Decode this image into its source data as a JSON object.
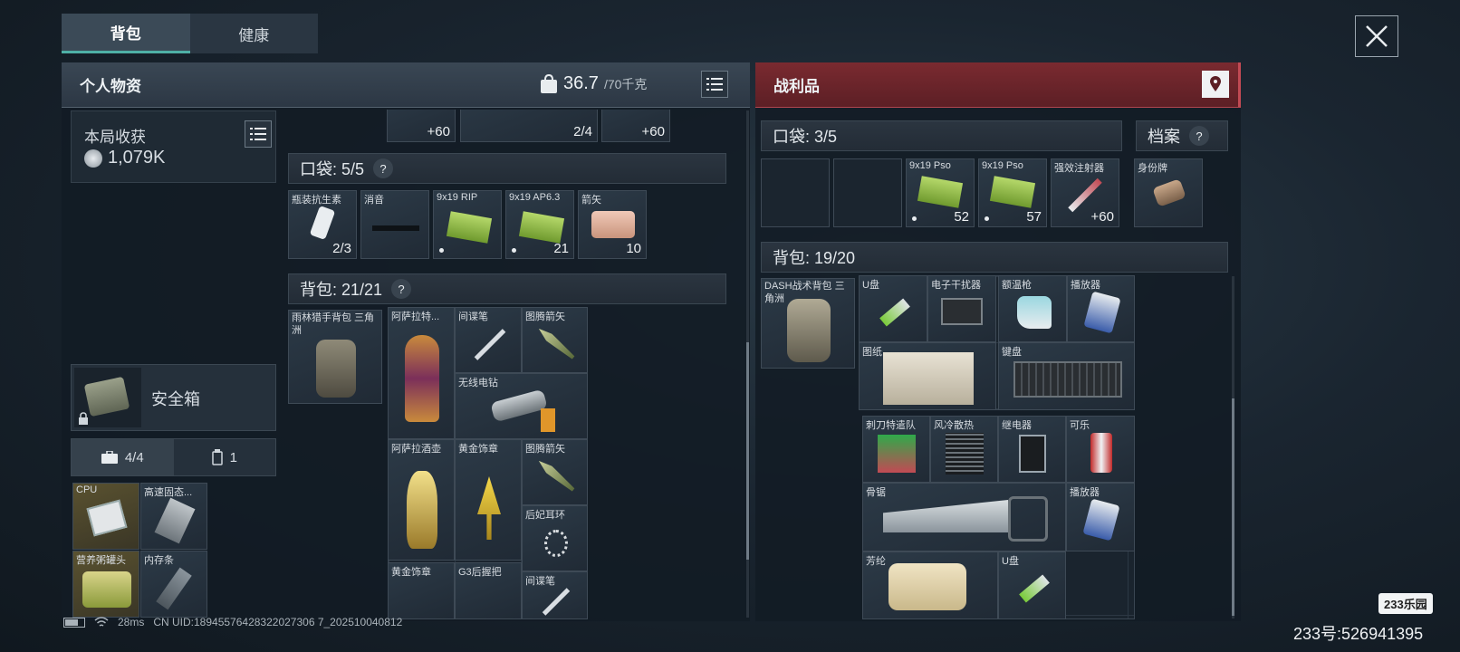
{
  "tabs": [
    "背包",
    "健康"
  ],
  "left_header": {
    "title": "个人物资",
    "weight": "36.7",
    "weight_max": "/70千克"
  },
  "right_header": {
    "title": "战利品"
  },
  "harvest": {
    "label": "本局收获",
    "value": "1,079K"
  },
  "safe_box": {
    "label": "安全箱"
  },
  "counters": {
    "case": "4/4",
    "ammo": "1"
  },
  "stash_items": [
    {
      "name": "CPU"
    },
    {
      "name": "高速固态..."
    },
    {
      "name": "营养粥罐头"
    },
    {
      "name": "内存条"
    }
  ],
  "top_row": [
    {
      "count": "+60"
    },
    {
      "count": "2/4"
    },
    {
      "count": "+60"
    }
  ],
  "pocket": {
    "label": "口袋: 5/5",
    "help": "?",
    "items": [
      {
        "name": "瓶装抗生素",
        "count": "2/3"
      },
      {
        "name": "消音",
        "count": ""
      },
      {
        "name": "9x19 RIP",
        "count": ""
      },
      {
        "name": "9x19 AP6.3",
        "count": "21"
      },
      {
        "name": "箭矢",
        "count": "10"
      }
    ]
  },
  "backpack": {
    "label": "背包: 21/21",
    "help": "?",
    "bag_name": "雨林猎手背包 三角洲",
    "items": [
      {
        "name": "阿萨拉特..."
      },
      {
        "name": "间谍笔"
      },
      {
        "name": "图腾箭矢"
      },
      {
        "name": "无线电钻"
      },
      {
        "name": "阿萨拉酒壶"
      },
      {
        "name": "黄金饰章"
      },
      {
        "name": "图腾箭矢"
      },
      {
        "name": "后妃耳环"
      },
      {
        "name": "黄金饰章"
      },
      {
        "name": "G3后握把"
      },
      {
        "name": "间谍笔"
      }
    ]
  },
  "loot_pocket": {
    "label": "口袋: 3/5",
    "items": [
      {
        "name": "9x19 Pso",
        "count": "52"
      },
      {
        "name": "9x19 Pso",
        "count": "57"
      },
      {
        "name": "强效注射器",
        "count": "+60"
      }
    ]
  },
  "archive": {
    "label": "档案",
    "help": "?",
    "item": "身份牌"
  },
  "loot_backpack": {
    "label": "背包: 19/20",
    "bag_name": "DASH战术背包 三角洲",
    "items": [
      {
        "name": "U盘"
      },
      {
        "name": "电子干扰器"
      },
      {
        "name": "额温枪"
      },
      {
        "name": "播放器"
      },
      {
        "name": "图纸"
      },
      {
        "name": "键盘"
      },
      {
        "name": "刺刀特遣队"
      },
      {
        "name": "风冷散热"
      },
      {
        "name": "继电器"
      },
      {
        "name": "可乐"
      },
      {
        "name": "骨锯"
      },
      {
        "name": "播放器"
      },
      {
        "name": "芳纶"
      },
      {
        "name": "U盘"
      }
    ]
  },
  "footer": {
    "ping": "28ms",
    "uid": "CN UID:18945576428322027306 7_202510040812"
  },
  "watermark": {
    "brand": "233乐园",
    "id": "233号:526941395"
  },
  "colors": {
    "accent": "#4fb0a6",
    "loot_red": "#7a2a30"
  }
}
